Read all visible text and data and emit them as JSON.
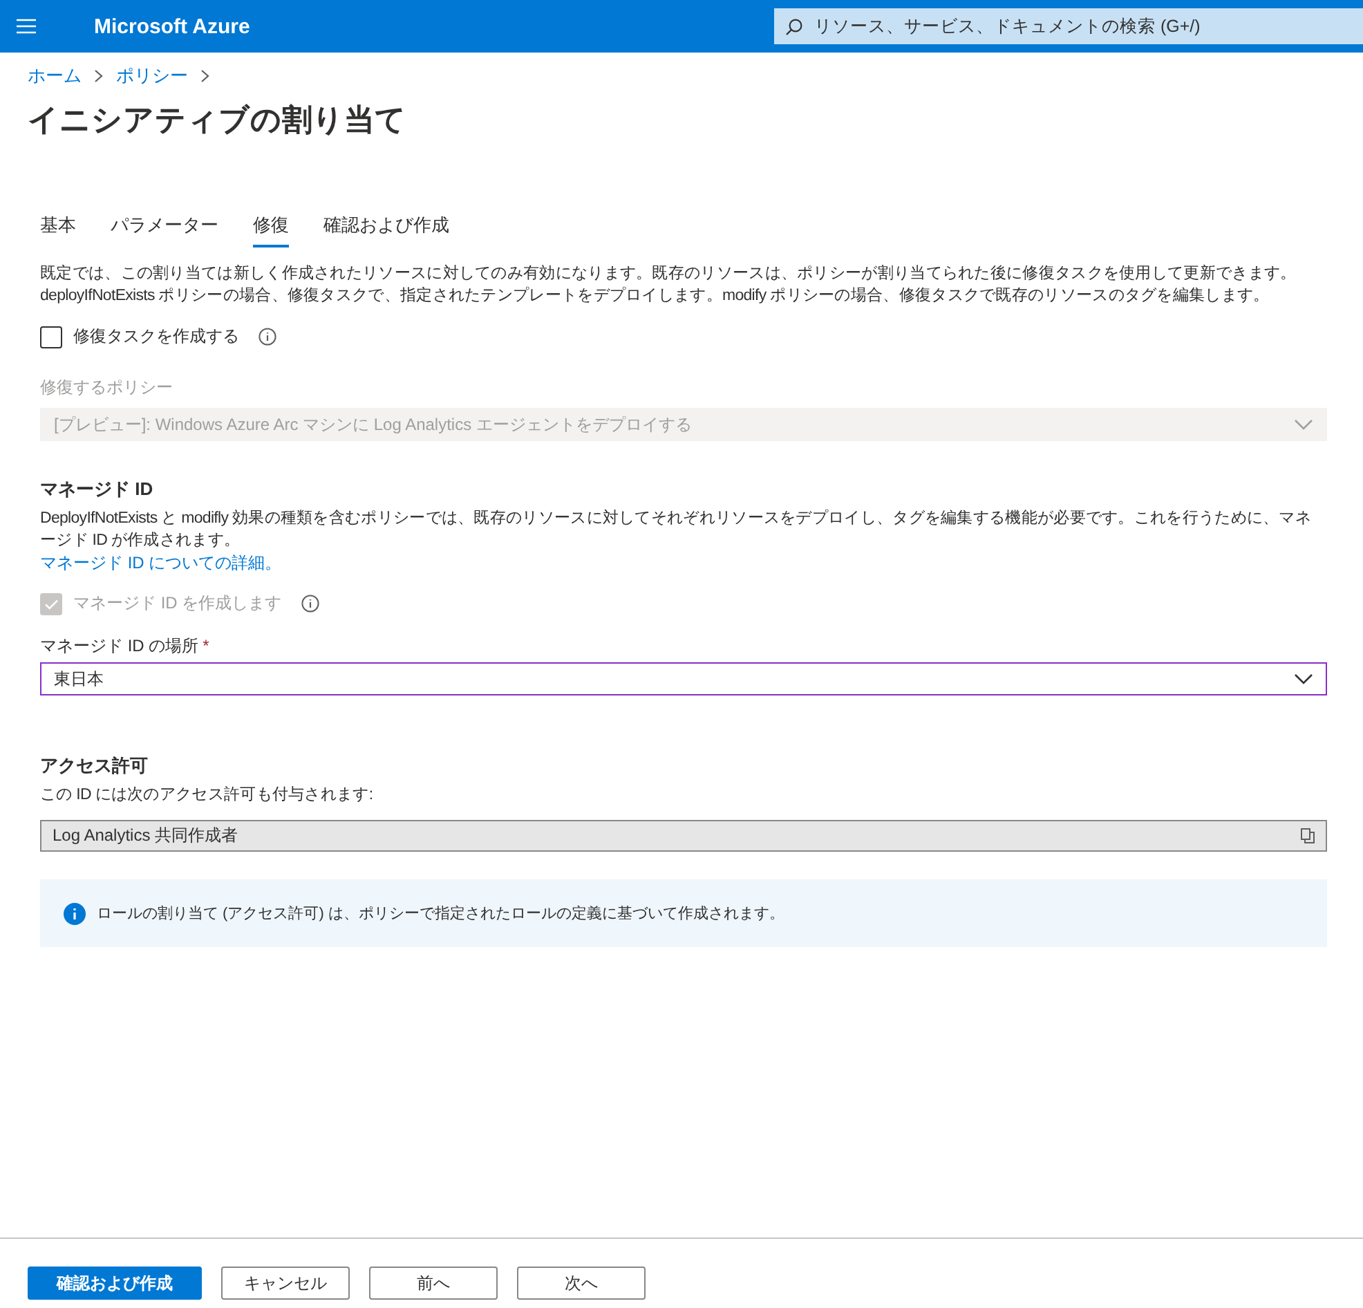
{
  "header": {
    "brand": "Microsoft Azure",
    "search": {
      "placeholder": "リソース、サービス、ドキュメントの検索 (G+/)"
    }
  },
  "breadcrumb": [
    "ホーム",
    "ポリシー"
  ],
  "title": "イニシアティブの割り当て",
  "tabs": [
    {
      "label": "基本",
      "selected": false
    },
    {
      "label": "パラメーター",
      "selected": false
    },
    {
      "label": "修復",
      "selected": true
    },
    {
      "label": "確認および作成",
      "selected": false
    }
  ],
  "description": "既定では、この割り当ては新しく作成されたリソースに対してのみ有効になります。既存のリソースは、ポリシーが割り当てられた後に修復タスクを使用して更新できます。deployIfNotExists ポリシーの場合、修復タスクで、指定されたテンプレートをデプロイします。modify ポリシーの場合、修復タスクで既存のリソースのタグを編集します。",
  "remediation_task": {
    "label": "修復タスクを作成する",
    "checked": false,
    "disabled": false
  },
  "remediation_policy": {
    "label": "修復するポリシー",
    "value": "[プレビュー]: Windows Azure Arc マシンに Log Analytics エージェントをデプロイする",
    "disabled": true
  },
  "managed_identity": {
    "heading": "マネージド ID",
    "description": "DeployIfNotExists と modifly 効果の種類を含むポリシーでは、既存のリソースに対してそれぞれリソースをデプロイし、タグを編集する機能が必要です。これを行うために、マネージド ID が作成されます。",
    "link": "マネージド ID についての詳細。",
    "create": {
      "label": "マネージド ID を作成します",
      "checked": true,
      "disabled": true
    },
    "location": {
      "label": "マネージド ID の場所",
      "required": true,
      "required_mark": "*",
      "value": "東日本"
    }
  },
  "permissions": {
    "heading": "アクセス許可",
    "description": "この ID には次のアクセス許可も付与されます:",
    "role": "Log Analytics 共同作成者"
  },
  "info_banner": "ロールの割り当て (アクセス許可) は、ポリシーで指定されたロールの定義に基づいて作成されます。",
  "footer_buttons": [
    {
      "label": "確認および作成",
      "kind": "primary"
    },
    {
      "label": "キャンセル",
      "kind": "secondary"
    },
    {
      "label": "前へ",
      "kind": "secondary"
    },
    {
      "label": "次へ",
      "kind": "secondary"
    }
  ]
}
